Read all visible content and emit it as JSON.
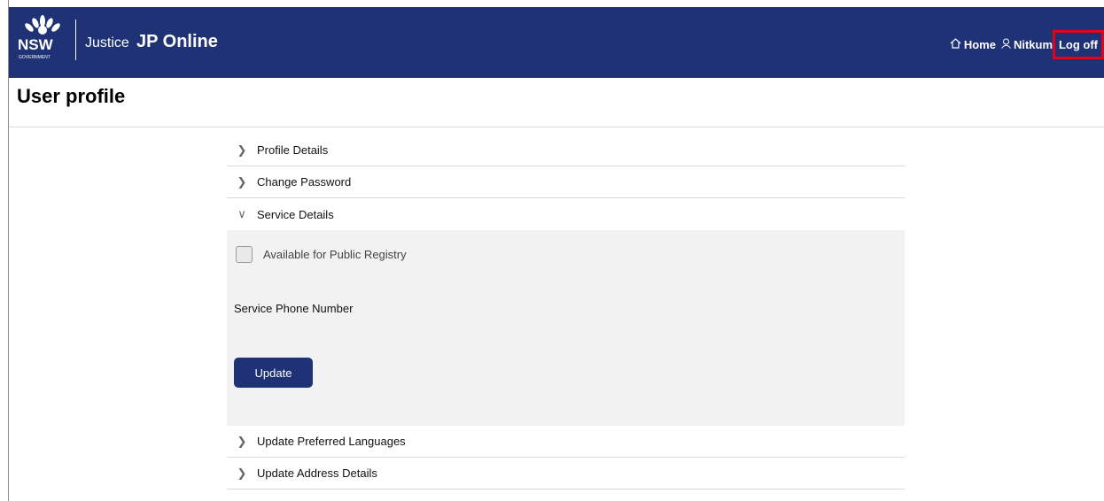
{
  "header": {
    "logo_top": "NSW",
    "logo_sub": "GOVERNMENT",
    "logo_justice": "Justice",
    "app_title": "JP Online",
    "nav": {
      "home_label": "Home",
      "user_label": "Nitkumar",
      "logoff_label": "Log off"
    }
  },
  "page": {
    "title": "User profile"
  },
  "accordion": {
    "items": [
      {
        "label": "Profile Details",
        "expanded": false
      },
      {
        "label": "Change Password",
        "expanded": false
      },
      {
        "label": "Service Details",
        "expanded": true
      },
      {
        "label": "Update Preferred Languages",
        "expanded": false
      },
      {
        "label": "Update Address Details",
        "expanded": false
      }
    ]
  },
  "service_details": {
    "checkbox_label": "Available for Public Registry",
    "checkbox_checked": false,
    "phone_label": "Service Phone Number",
    "update_label": "Update"
  },
  "colors": {
    "brand_navy": "#1f3275",
    "highlight_red": "#e6001a"
  }
}
